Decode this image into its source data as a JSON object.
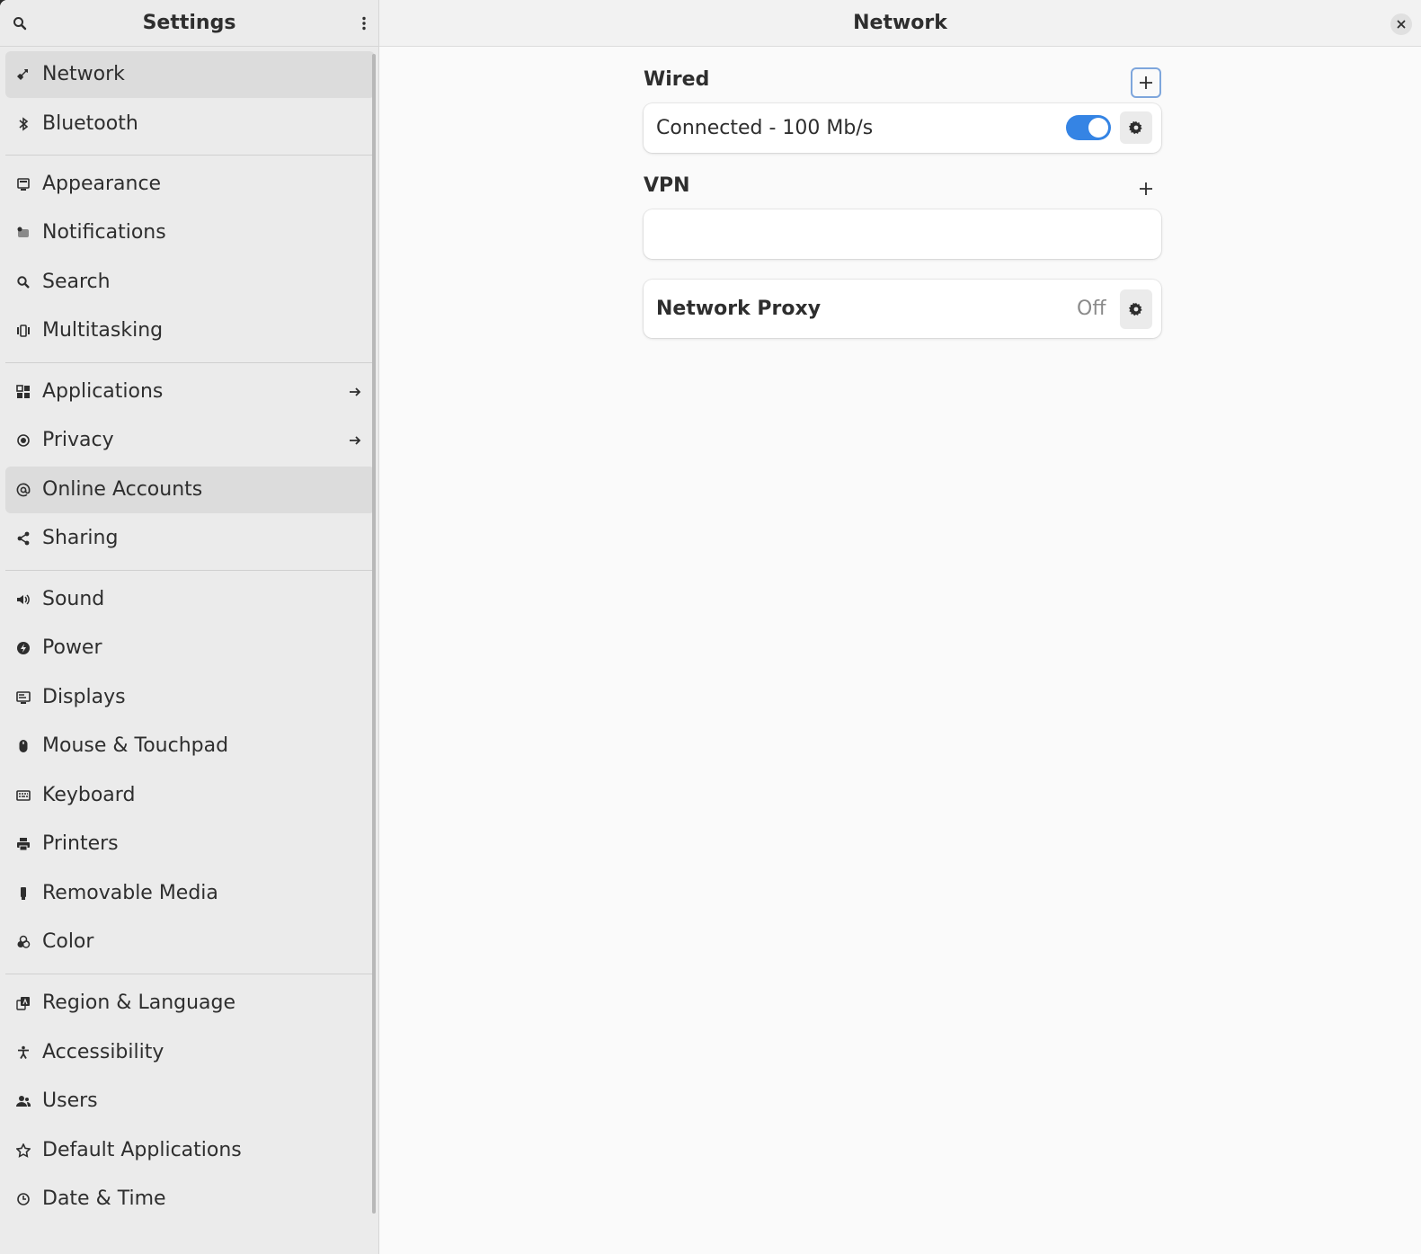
{
  "sidebar": {
    "title": "Settings",
    "items": [
      {
        "label": "Network",
        "icon": "network-wired-icon"
      },
      {
        "label": "Bluetooth",
        "icon": "bluetooth-icon"
      },
      {
        "label": "Appearance",
        "icon": "appearance-icon"
      },
      {
        "label": "Notifications",
        "icon": "notifications-icon"
      },
      {
        "label": "Search",
        "icon": "search-icon"
      },
      {
        "label": "Multitasking",
        "icon": "multitasking-icon"
      },
      {
        "label": "Applications",
        "icon": "applications-icon"
      },
      {
        "label": "Privacy",
        "icon": "privacy-icon"
      },
      {
        "label": "Online Accounts",
        "icon": "online-accounts-icon"
      },
      {
        "label": "Sharing",
        "icon": "sharing-icon"
      },
      {
        "label": "Sound",
        "icon": "sound-icon"
      },
      {
        "label": "Power",
        "icon": "power-icon"
      },
      {
        "label": "Displays",
        "icon": "displays-icon"
      },
      {
        "label": "Mouse & Touchpad",
        "icon": "mouse-icon"
      },
      {
        "label": "Keyboard",
        "icon": "keyboard-icon"
      },
      {
        "label": "Printers",
        "icon": "printer-icon"
      },
      {
        "label": "Removable Media",
        "icon": "removable-media-icon"
      },
      {
        "label": "Color",
        "icon": "color-icon"
      },
      {
        "label": "Region & Language",
        "icon": "region-language-icon"
      },
      {
        "label": "Accessibility",
        "icon": "accessibility-icon"
      },
      {
        "label": "Users",
        "icon": "users-icon"
      },
      {
        "label": "Default Applications",
        "icon": "default-applications-icon"
      },
      {
        "label": "Date & Time",
        "icon": "clock-icon"
      }
    ]
  },
  "main": {
    "title": "Network",
    "wired": {
      "title": "Wired",
      "status": "Connected - 100 Mb/s",
      "enabled": true
    },
    "vpn": {
      "title": "VPN"
    },
    "proxy": {
      "label": "Network Proxy",
      "value": "Off"
    }
  },
  "colors": {
    "accent": "#3584e4",
    "sidebar_bg": "#ebebeb",
    "content_bg": "#fafafa"
  }
}
